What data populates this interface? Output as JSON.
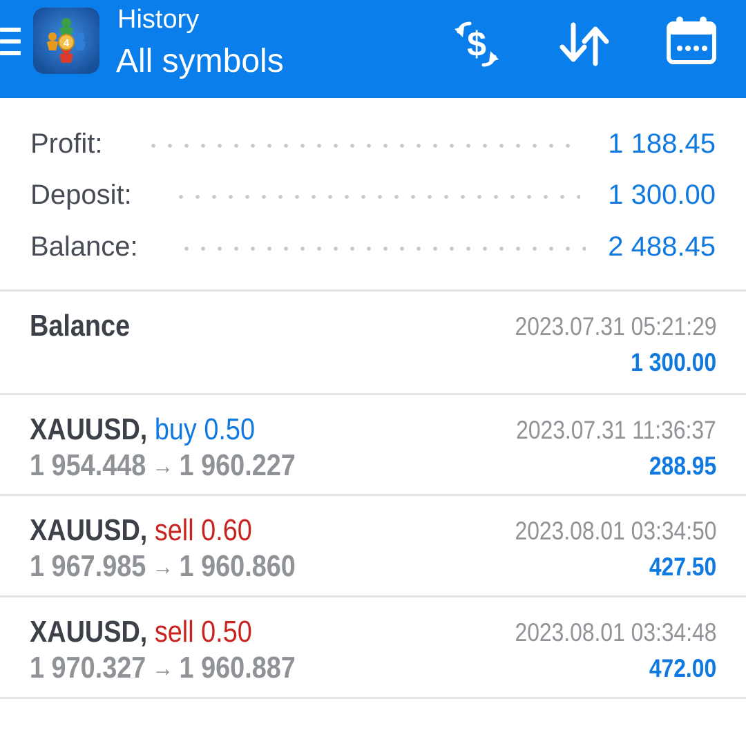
{
  "header": {
    "subtitle": "History",
    "title": "All symbols",
    "menu_icon": "hamburger-menu-icon",
    "logo_icon": "metatrader-4-logo",
    "actions": [
      {
        "icon": "dollar-exchange-icon"
      },
      {
        "icon": "sort-arrows-icon"
      },
      {
        "icon": "calendar-icon"
      }
    ]
  },
  "summary": {
    "profit_label": "Profit:",
    "profit_value": "1 188.45",
    "deposit_label": "Deposit:",
    "deposit_value": "1 300.00",
    "balance_label": "Balance:",
    "balance_value": "2 488.45"
  },
  "deals": [
    {
      "symbol": "Balance",
      "direction": "",
      "volume": "",
      "open_price": "",
      "close_price": "",
      "time": "2023.07.31 05:21:29",
      "profit": "1 300.00"
    },
    {
      "symbol": "XAUUSD,",
      "direction": "buy",
      "volume": "0.50",
      "open_price": "1 954.448",
      "close_price": "1 960.227",
      "arrow": "→",
      "time": "2023.07.31 11:36:37",
      "profit": "288.95"
    },
    {
      "symbol": "XAUUSD,",
      "direction": "sell",
      "volume": "0.60",
      "open_price": "1 967.985",
      "close_price": "1 960.860",
      "arrow": "→",
      "time": "2023.08.01 03:34:50",
      "profit": "427.50"
    },
    {
      "symbol": "XAUUSD,",
      "direction": "sell",
      "volume": "0.50",
      "open_price": "1 970.327",
      "close_price": "1 960.887",
      "arrow": "→",
      "time": "2023.08.01 03:34:48",
      "profit": "472.00"
    }
  ],
  "colors": {
    "header_bg": "#0a7eea",
    "accent_blue": "#1079e0",
    "sell_red": "#c8231f",
    "text_dark": "#3c4049",
    "text_gray": "#8f9297"
  }
}
